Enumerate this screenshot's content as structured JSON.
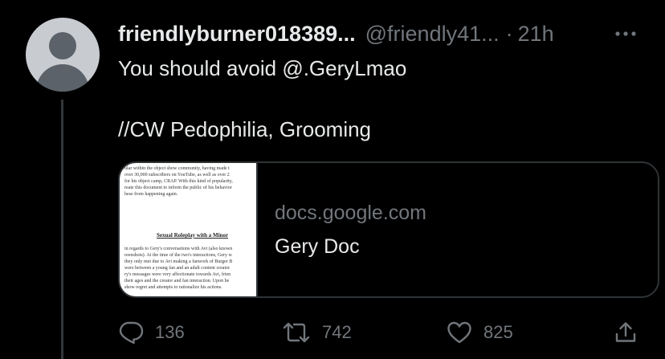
{
  "tweet": {
    "display_name": "friendlyburner018389...",
    "handle": "@friendly41...",
    "separator": "·",
    "time": "21h",
    "text_lines": [
      "You should avoid @.GeryLmao",
      "",
      "//CW Pedophilia, Grooming"
    ],
    "more_icon": "more-horizontal-icon"
  },
  "card": {
    "domain": "docs.google.com",
    "title": "Gery Doc",
    "thumbnail": {
      "lines_top": [
        "ular within the object show community, having made t",
        "over 30,000 subscribers on YouTube, as well as over 2",
        "for his object camp, CRAP. With this kind of popularity,",
        "reate this document to inform the public of his behavior",
        "hese from happening again."
      ],
      "heading": "Sexual Roleplay with a Minor",
      "lines_bottom": [
        "in regards to Gery's conversations with Avi (also known",
        "reenshots). At the time of the two's interactions, Gery w",
        "they only met due to Avi making a fanwork of Burger B",
        "were between a young fan and an adult content creator",
        "ry's messages were very affectionate towards Avi, frien",
        "their ages and the creator and fan interaction. Upon be",
        "show regret and attempts to rationalize his actions."
      ]
    }
  },
  "actions": {
    "replies": "136",
    "retweets": "742",
    "likes": "825"
  },
  "icons": {
    "reply": "reply-icon",
    "retweet": "retweet-icon",
    "like": "heart-icon",
    "share": "share-icon"
  },
  "colors": {
    "background": "#000000",
    "primary_text": "#e7e9ea",
    "secondary_text": "#71767b",
    "border": "#2f3336"
  }
}
